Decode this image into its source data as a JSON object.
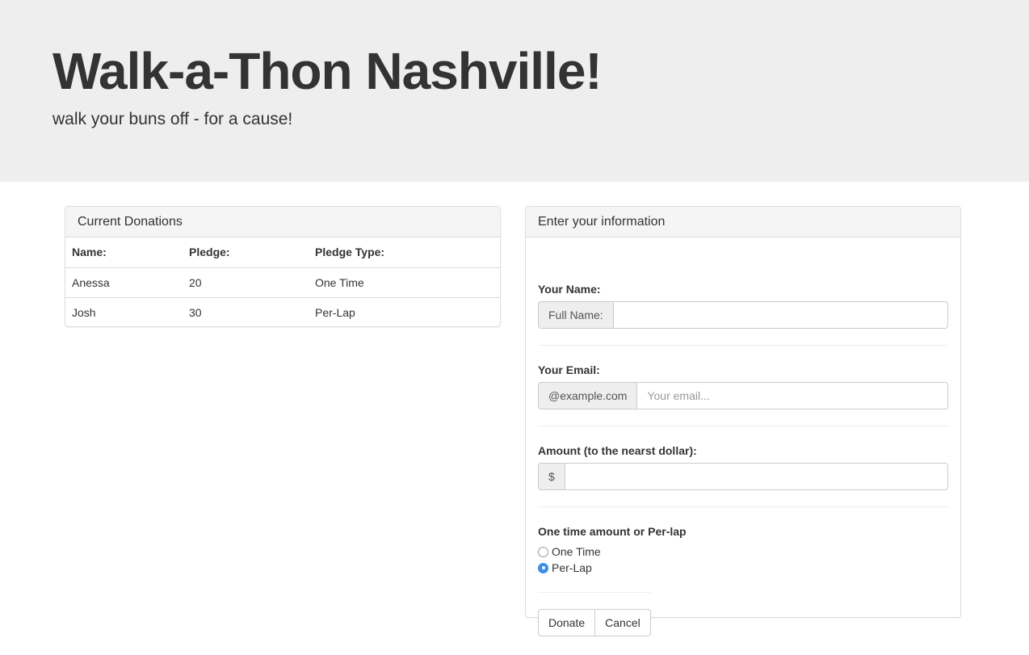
{
  "header": {
    "title": "Walk-a-Thon Nashville!",
    "subtitle": "walk your buns off - for a cause!"
  },
  "donations": {
    "heading": "Current Donations",
    "columns": [
      "Name:",
      "Pledge:",
      "Pledge Type:"
    ],
    "rows": [
      [
        "Anessa",
        "20",
        "One Time"
      ],
      [
        "Josh",
        "30",
        "Per-Lap"
      ]
    ]
  },
  "form": {
    "heading": "Enter your information",
    "name": {
      "label": "Your Name:",
      "addon": "Full Name:",
      "value": "",
      "placeholder": ""
    },
    "email": {
      "label": "Your Email:",
      "addon": "@example.com",
      "value": "",
      "placeholder": "Your email..."
    },
    "amount": {
      "label": "Amount (to the nearst dollar):",
      "addon": "$",
      "value": "",
      "placeholder": ""
    },
    "pledge_type": {
      "label": "One time amount or Per-lap",
      "options": [
        "One Time",
        "Per-Lap"
      ],
      "selected": "Per-Lap"
    },
    "buttons": {
      "donate": "Donate",
      "cancel": "Cancel"
    }
  },
  "colors": {
    "jumbotron_bg": "#eeeeee",
    "panel_heading_bg": "#f5f5f5",
    "radio_checked": "#3b8eea"
  }
}
